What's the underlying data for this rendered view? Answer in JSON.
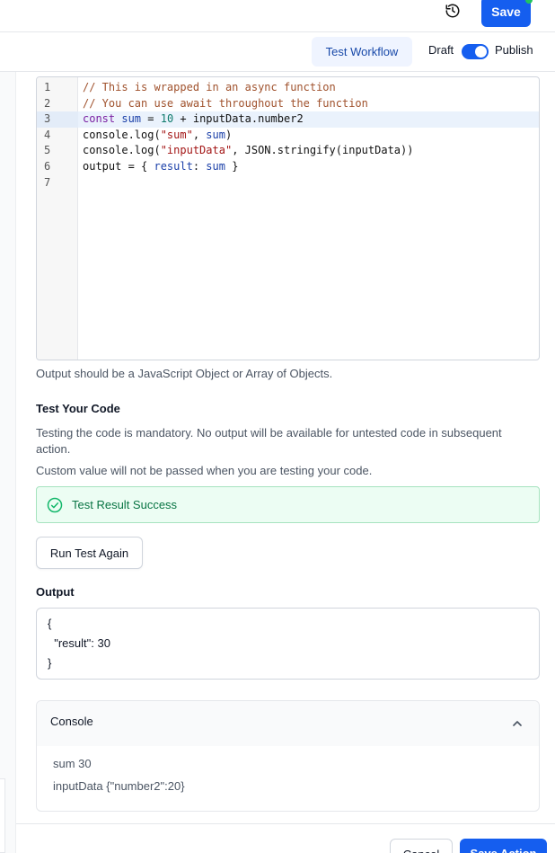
{
  "header": {
    "save_label": "Save",
    "history_icon": "history-icon"
  },
  "subheader": {
    "test_workflow_label": "Test Workflow",
    "draft_label": "Draft",
    "publish_label": "Publish",
    "publish_toggle_on": true
  },
  "editor": {
    "line_numbers": [
      "1",
      "2",
      "3",
      "4",
      "5",
      "6",
      "7"
    ],
    "active_line": 3,
    "lines": [
      "// This is wrapped in an async function",
      "// You can use await throughout the function",
      "const sum = 10 + inputData.number2",
      "console.log(\"sum\", sum)",
      "console.log(\"inputData\", JSON.stringify(inputData))",
      "output = { result: sum }",
      ""
    ]
  },
  "helper_text": "Output should be a JavaScript Object or Array of Objects.",
  "test": {
    "heading": "Test Your Code",
    "mandatory_note": "Testing the code is mandatory. No output will be available for untested code in subsequent action.",
    "custom_value_note": "Custom value will not be passed when you are testing your code.",
    "result_label": "Test Result Success",
    "run_again_label": "Run Test Again"
  },
  "output": {
    "heading": "Output",
    "lines": [
      "{",
      "  \"result\": 30",
      "}"
    ]
  },
  "console": {
    "title": "Console",
    "lines": [
      "sum 30",
      "inputData {\"number2\":20}"
    ]
  },
  "footer": {
    "cancel_label": "Cancel",
    "save_action_label": "Save Action"
  },
  "colors": {
    "primary": "#155eef",
    "success_bg": "#ecfdf3",
    "success_text": "#087443",
    "notify_dot": "#22c55e"
  }
}
